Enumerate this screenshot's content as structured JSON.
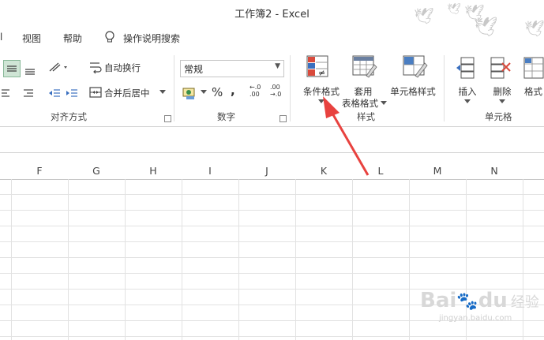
{
  "window": {
    "title": "工作簿2  -  Excel"
  },
  "menu": {
    "view": "视图",
    "help": "帮助",
    "search": "操作说明搜索"
  },
  "alignment": {
    "wrap_text": "自动换行",
    "merge_center": "合并后居中",
    "group_label": "对齐方式"
  },
  "number": {
    "format_value": "常规",
    "percent": "%",
    "comma": ",",
    "inc_decimal_a": "←.0",
    "inc_decimal_b": ".00",
    "dec_decimal_a": ".00",
    "dec_decimal_b": "→.0",
    "group_label": "数字"
  },
  "styles": {
    "conditional_format": "条件格式",
    "format_as_table_1": "套用",
    "format_as_table_2": "表格格式",
    "cell_styles": "单元格样式",
    "group_label": "样式"
  },
  "cells": {
    "insert": "插入",
    "delete": "删除",
    "format": "格式",
    "group_label": "单元格"
  },
  "columns": [
    "F",
    "G",
    "H",
    "I",
    "J",
    "K",
    "L",
    "M",
    "N"
  ],
  "watermark": {
    "brand": "Bai",
    "brand2": "du",
    "brand3": "经验",
    "url": "jingyan.baidu.com"
  },
  "colors": {
    "arrow": "#e8423f",
    "accent_green": "#217346"
  }
}
